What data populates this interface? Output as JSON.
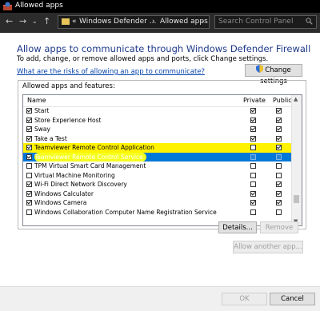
{
  "window": {
    "title": "Allowed apps"
  },
  "nav": {
    "back": "←",
    "forward": "→",
    "dropdown": "⌄",
    "up": "↑",
    "address": [
      "«",
      "Windows Defender ...",
      "›",
      "Allowed apps"
    ],
    "address_dropdown": "⌄",
    "refresh": "↻",
    "search_placeholder": "Search Control Panel",
    "search_icon": "search-icon"
  },
  "heading": "Allow apps to communicate through Windows Defender Firewall",
  "subheading": "To add, change, or remove allowed apps and ports, click Change settings.",
  "risk_link": "What are the risks of allowing an app to communicate?",
  "change_settings": "Change settings",
  "group_title": "Allowed apps and features:",
  "columns": {
    "name": "Name",
    "private": "Private",
    "public": "Public"
  },
  "rows": [
    {
      "name": "Start",
      "enabled": true,
      "private": true,
      "public": true,
      "highlight": false,
      "selected": false
    },
    {
      "name": "Store Experience Host",
      "enabled": true,
      "private": true,
      "public": true,
      "highlight": false,
      "selected": false
    },
    {
      "name": "Sway",
      "enabled": true,
      "private": true,
      "public": true,
      "highlight": false,
      "selected": false
    },
    {
      "name": "Take a Test",
      "enabled": true,
      "private": true,
      "public": true,
      "highlight": false,
      "selected": false
    },
    {
      "name": "Teamviewer Remote Control Application",
      "enabled": true,
      "private": false,
      "public": true,
      "highlight": true,
      "selected": false
    },
    {
      "name": "Teamviewer Remote Control Service",
      "enabled": true,
      "private": false,
      "public": false,
      "highlight": true,
      "selected": true
    },
    {
      "name": "TPM Virtual Smart Card Management",
      "enabled": false,
      "private": false,
      "public": false,
      "highlight": false,
      "selected": false
    },
    {
      "name": "Virtual Machine Monitoring",
      "enabled": false,
      "private": false,
      "public": false,
      "highlight": false,
      "selected": false
    },
    {
      "name": "Wi-Fi Direct Network Discovery",
      "enabled": true,
      "private": false,
      "public": true,
      "highlight": false,
      "selected": false
    },
    {
      "name": "Windows Calculator",
      "enabled": true,
      "private": true,
      "public": true,
      "highlight": false,
      "selected": false
    },
    {
      "name": "Windows Camera",
      "enabled": true,
      "private": true,
      "public": true,
      "highlight": false,
      "selected": false
    },
    {
      "name": "Windows Collaboration Computer Name Registration Service",
      "enabled": false,
      "private": false,
      "public": false,
      "highlight": false,
      "selected": false
    }
  ],
  "details_button": "Details...",
  "remove_button": "Remove",
  "allow_another_button": "Allow another app...",
  "ok_button": "OK",
  "cancel_button": "Cancel",
  "colors": {
    "title_text": "#1e3a8a",
    "link": "#0645ad",
    "selection": "#0078d7",
    "highlight": "#fff200"
  }
}
